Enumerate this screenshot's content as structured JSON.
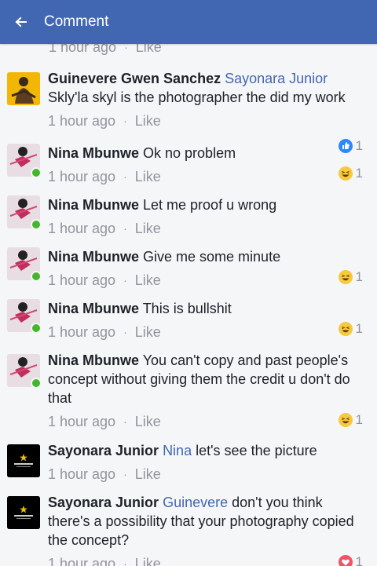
{
  "header": {
    "title": "Comment"
  },
  "partial": {
    "time": "1 hour ago",
    "separator": "·",
    "like": "Like"
  },
  "comments": [
    {
      "author": "Guinevere Gwen Sanchez",
      "mention": "Sayonara Junior",
      "text": "Skly'la skyl is the photographer the did my work",
      "time": "1 hour ago",
      "like": "Like",
      "reaction": "like",
      "reaction_count": "1"
    },
    {
      "author": "Nina Mbunwe",
      "mention": "",
      "text": "Ok no problem",
      "time": "1 hour ago",
      "like": "Like",
      "reaction": "haha",
      "reaction_count": "1"
    },
    {
      "author": "Nina Mbunwe",
      "mention": "",
      "text": "Let me proof u wrong",
      "time": "1 hour ago",
      "like": "Like",
      "reaction": "",
      "reaction_count": ""
    },
    {
      "author": "Nina Mbunwe",
      "mention": "",
      "text": "Give me some minute",
      "time": "1 hour ago",
      "like": "Like",
      "reaction": "haha",
      "reaction_count": "1"
    },
    {
      "author": "Nina Mbunwe",
      "mention": "",
      "text": "This is bullshit",
      "time": "1 hour ago",
      "like": "Like",
      "reaction": "haha",
      "reaction_count": "1"
    },
    {
      "author": "Nina Mbunwe",
      "mention": "",
      "text": "You can't copy and past people's concept without giving them the credit u don't do that",
      "time": "1 hour ago",
      "like": "Like",
      "reaction": "haha",
      "reaction_count": "1"
    },
    {
      "author": "Sayonara Junior",
      "mention": "Nina",
      "text": "let's see the picture",
      "time": "1 hour ago",
      "like": "Like",
      "reaction": "",
      "reaction_count": ""
    },
    {
      "author": "Sayonara Junior",
      "mention": "Guinevere",
      "text": "don't you think there's a possibility that your photography copied the concept?",
      "time": "1 hour ago",
      "like": "Like",
      "reaction": "love",
      "reaction_count": "1"
    }
  ],
  "colors": {
    "header": "#4267b2",
    "mention": "#4267b2",
    "meta": "#90949c",
    "online": "#42b72a"
  },
  "icons": {
    "back": "back-arrow-icon",
    "like": "like-reaction-icon",
    "haha": "haha-reaction-icon",
    "love": "love-reaction-icon"
  }
}
